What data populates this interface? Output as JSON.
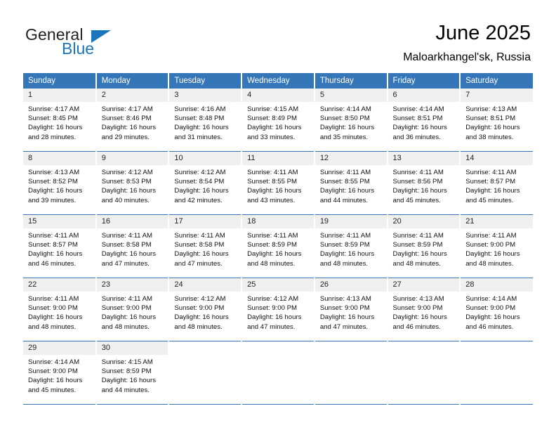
{
  "brand": {
    "name_part1": "General",
    "name_part2": "Blue",
    "accent_color": "#1b75bb"
  },
  "header": {
    "title": "June 2025",
    "subtitle": "Maloarkhangel'sk, Russia"
  },
  "theme": {
    "header_row_bg": "#3576b8",
    "daynum_bg": "#f0f0f0",
    "grid_line": "#3576b8"
  },
  "calendar": {
    "weekday_headers": [
      "Sunday",
      "Monday",
      "Tuesday",
      "Wednesday",
      "Thursday",
      "Friday",
      "Saturday"
    ],
    "weeks": [
      [
        {
          "day": "1",
          "sunrise": "Sunrise: 4:17 AM",
          "sunset": "Sunset: 8:45 PM",
          "daylight_1": "Daylight: 16 hours",
          "daylight_2": "and 28 minutes."
        },
        {
          "day": "2",
          "sunrise": "Sunrise: 4:17 AM",
          "sunset": "Sunset: 8:46 PM",
          "daylight_1": "Daylight: 16 hours",
          "daylight_2": "and 29 minutes."
        },
        {
          "day": "3",
          "sunrise": "Sunrise: 4:16 AM",
          "sunset": "Sunset: 8:48 PM",
          "daylight_1": "Daylight: 16 hours",
          "daylight_2": "and 31 minutes."
        },
        {
          "day": "4",
          "sunrise": "Sunrise: 4:15 AM",
          "sunset": "Sunset: 8:49 PM",
          "daylight_1": "Daylight: 16 hours",
          "daylight_2": "and 33 minutes."
        },
        {
          "day": "5",
          "sunrise": "Sunrise: 4:14 AM",
          "sunset": "Sunset: 8:50 PM",
          "daylight_1": "Daylight: 16 hours",
          "daylight_2": "and 35 minutes."
        },
        {
          "day": "6",
          "sunrise": "Sunrise: 4:14 AM",
          "sunset": "Sunset: 8:51 PM",
          "daylight_1": "Daylight: 16 hours",
          "daylight_2": "and 36 minutes."
        },
        {
          "day": "7",
          "sunrise": "Sunrise: 4:13 AM",
          "sunset": "Sunset: 8:51 PM",
          "daylight_1": "Daylight: 16 hours",
          "daylight_2": "and 38 minutes."
        }
      ],
      [
        {
          "day": "8",
          "sunrise": "Sunrise: 4:13 AM",
          "sunset": "Sunset: 8:52 PM",
          "daylight_1": "Daylight: 16 hours",
          "daylight_2": "and 39 minutes."
        },
        {
          "day": "9",
          "sunrise": "Sunrise: 4:12 AM",
          "sunset": "Sunset: 8:53 PM",
          "daylight_1": "Daylight: 16 hours",
          "daylight_2": "and 40 minutes."
        },
        {
          "day": "10",
          "sunrise": "Sunrise: 4:12 AM",
          "sunset": "Sunset: 8:54 PM",
          "daylight_1": "Daylight: 16 hours",
          "daylight_2": "and 42 minutes."
        },
        {
          "day": "11",
          "sunrise": "Sunrise: 4:11 AM",
          "sunset": "Sunset: 8:55 PM",
          "daylight_1": "Daylight: 16 hours",
          "daylight_2": "and 43 minutes."
        },
        {
          "day": "12",
          "sunrise": "Sunrise: 4:11 AM",
          "sunset": "Sunset: 8:55 PM",
          "daylight_1": "Daylight: 16 hours",
          "daylight_2": "and 44 minutes."
        },
        {
          "day": "13",
          "sunrise": "Sunrise: 4:11 AM",
          "sunset": "Sunset: 8:56 PM",
          "daylight_1": "Daylight: 16 hours",
          "daylight_2": "and 45 minutes."
        },
        {
          "day": "14",
          "sunrise": "Sunrise: 4:11 AM",
          "sunset": "Sunset: 8:57 PM",
          "daylight_1": "Daylight: 16 hours",
          "daylight_2": "and 45 minutes."
        }
      ],
      [
        {
          "day": "15",
          "sunrise": "Sunrise: 4:11 AM",
          "sunset": "Sunset: 8:57 PM",
          "daylight_1": "Daylight: 16 hours",
          "daylight_2": "and 46 minutes."
        },
        {
          "day": "16",
          "sunrise": "Sunrise: 4:11 AM",
          "sunset": "Sunset: 8:58 PM",
          "daylight_1": "Daylight: 16 hours",
          "daylight_2": "and 47 minutes."
        },
        {
          "day": "17",
          "sunrise": "Sunrise: 4:11 AM",
          "sunset": "Sunset: 8:58 PM",
          "daylight_1": "Daylight: 16 hours",
          "daylight_2": "and 47 minutes."
        },
        {
          "day": "18",
          "sunrise": "Sunrise: 4:11 AM",
          "sunset": "Sunset: 8:59 PM",
          "daylight_1": "Daylight: 16 hours",
          "daylight_2": "and 48 minutes."
        },
        {
          "day": "19",
          "sunrise": "Sunrise: 4:11 AM",
          "sunset": "Sunset: 8:59 PM",
          "daylight_1": "Daylight: 16 hours",
          "daylight_2": "and 48 minutes."
        },
        {
          "day": "20",
          "sunrise": "Sunrise: 4:11 AM",
          "sunset": "Sunset: 8:59 PM",
          "daylight_1": "Daylight: 16 hours",
          "daylight_2": "and 48 minutes."
        },
        {
          "day": "21",
          "sunrise": "Sunrise: 4:11 AM",
          "sunset": "Sunset: 9:00 PM",
          "daylight_1": "Daylight: 16 hours",
          "daylight_2": "and 48 minutes."
        }
      ],
      [
        {
          "day": "22",
          "sunrise": "Sunrise: 4:11 AM",
          "sunset": "Sunset: 9:00 PM",
          "daylight_1": "Daylight: 16 hours",
          "daylight_2": "and 48 minutes."
        },
        {
          "day": "23",
          "sunrise": "Sunrise: 4:11 AM",
          "sunset": "Sunset: 9:00 PM",
          "daylight_1": "Daylight: 16 hours",
          "daylight_2": "and 48 minutes."
        },
        {
          "day": "24",
          "sunrise": "Sunrise: 4:12 AM",
          "sunset": "Sunset: 9:00 PM",
          "daylight_1": "Daylight: 16 hours",
          "daylight_2": "and 48 minutes."
        },
        {
          "day": "25",
          "sunrise": "Sunrise: 4:12 AM",
          "sunset": "Sunset: 9:00 PM",
          "daylight_1": "Daylight: 16 hours",
          "daylight_2": "and 47 minutes."
        },
        {
          "day": "26",
          "sunrise": "Sunrise: 4:13 AM",
          "sunset": "Sunset: 9:00 PM",
          "daylight_1": "Daylight: 16 hours",
          "daylight_2": "and 47 minutes."
        },
        {
          "day": "27",
          "sunrise": "Sunrise: 4:13 AM",
          "sunset": "Sunset: 9:00 PM",
          "daylight_1": "Daylight: 16 hours",
          "daylight_2": "and 46 minutes."
        },
        {
          "day": "28",
          "sunrise": "Sunrise: 4:14 AM",
          "sunset": "Sunset: 9:00 PM",
          "daylight_1": "Daylight: 16 hours",
          "daylight_2": "and 46 minutes."
        }
      ],
      [
        {
          "day": "29",
          "sunrise": "Sunrise: 4:14 AM",
          "sunset": "Sunset: 9:00 PM",
          "daylight_1": "Daylight: 16 hours",
          "daylight_2": "and 45 minutes."
        },
        {
          "day": "30",
          "sunrise": "Sunrise: 4:15 AM",
          "sunset": "Sunset: 8:59 PM",
          "daylight_1": "Daylight: 16 hours",
          "daylight_2": "and 44 minutes."
        },
        {
          "day": "",
          "sunrise": "",
          "sunset": "",
          "daylight_1": "",
          "daylight_2": ""
        },
        {
          "day": "",
          "sunrise": "",
          "sunset": "",
          "daylight_1": "",
          "daylight_2": ""
        },
        {
          "day": "",
          "sunrise": "",
          "sunset": "",
          "daylight_1": "",
          "daylight_2": ""
        },
        {
          "day": "",
          "sunrise": "",
          "sunset": "",
          "daylight_1": "",
          "daylight_2": ""
        },
        {
          "day": "",
          "sunrise": "",
          "sunset": "",
          "daylight_1": "",
          "daylight_2": ""
        }
      ]
    ]
  }
}
